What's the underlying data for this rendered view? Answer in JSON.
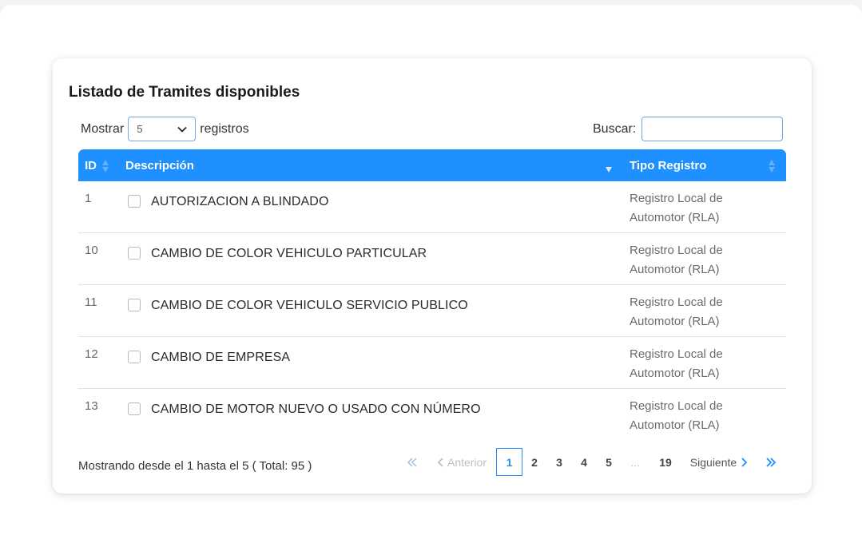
{
  "card": {
    "title": "Listado de Tramites disponibles"
  },
  "length": {
    "prefix": "Mostrar",
    "value": "5",
    "suffix": "registros"
  },
  "search": {
    "label": "Buscar:",
    "value": ""
  },
  "table": {
    "headers": {
      "id": "ID",
      "descripcion": "Descripción",
      "tipo": "Tipo Registro"
    },
    "rows": [
      {
        "id": "1",
        "descripcion": "AUTORIZACION A BLINDADO",
        "tipo": "Registro Local de Automotor (RLA)"
      },
      {
        "id": "10",
        "descripcion": "CAMBIO DE COLOR VEHICULO PARTICULAR",
        "tipo": "Registro Local de Automotor (RLA)"
      },
      {
        "id": "11",
        "descripcion": "CAMBIO DE COLOR VEHICULO SERVICIO PUBLICO",
        "tipo": "Registro Local de Automotor (RLA)"
      },
      {
        "id": "12",
        "descripcion": "CAMBIO DE EMPRESA",
        "tipo": "Registro Local de Automotor (RLA)"
      },
      {
        "id": "13",
        "descripcion": "CAMBIO DE MOTOR NUEVO O USADO CON NÚMERO",
        "tipo": "Registro Local de Automotor (RLA)"
      }
    ]
  },
  "info": "Mostrando desde el 1 hasta el 5 ( Total: 95 )",
  "pagination": {
    "first_icon": "double-chevron-left-icon",
    "prev_label": "Anterior",
    "pages": [
      "1",
      "2",
      "3",
      "4",
      "5"
    ],
    "ellipsis": "...",
    "last_page": "19",
    "next_label": "Siguiente",
    "last_icon": "double-chevron-right-icon",
    "current": "1"
  },
  "colors": {
    "header_bg": "#1e90ff",
    "accent": "#1e90ff"
  }
}
